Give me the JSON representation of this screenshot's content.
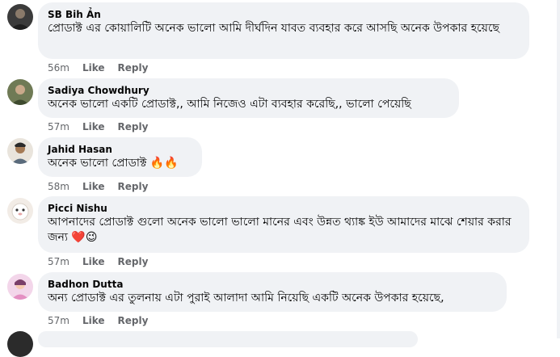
{
  "comments": [
    {
      "author": "SB Bih Ản",
      "text": "প্রোডাক্ট এর কোয়ালিটি অনেক ভালো আমি দীর্ঘদিন যাবত ব্যবহার করে আসছি অনেক উপকার হয়েছে",
      "time": "56m",
      "like": "Like",
      "reply": "Reply",
      "emoji": ""
    },
    {
      "author": "Sadiya Chowdhury",
      "text": "অনেক ভালো একটি প্রোডাক্ট,, আমি নিজেও এটা ব্যবহার করেছি,, ভালো পেয়েছি",
      "time": "57m",
      "like": "Like",
      "reply": "Reply",
      "emoji": ""
    },
    {
      "author": "Jahid Hasan",
      "text": "অনেক ভালো প্রোডাক্ট",
      "time": "58m",
      "like": "Like",
      "reply": "Reply",
      "emoji": "🔥🔥"
    },
    {
      "author": "Picci Nishu",
      "text": "আপনাদের প্রোডাক্ট গুলো অনেক ভালো ভালো মানের এবং উন্নত থ্যাঙ্ক ইউ আমাদের মাঝে শেয়ার করার জন্য",
      "time": "57m",
      "like": "Like",
      "reply": "Reply",
      "emoji": "❤️😉"
    },
    {
      "author": "Badhon Dutta",
      "text": "অন্য প্রোডাক্ট এর তুলনায় এটা পুরাই আলাদা আমি নিয়েছি একটি অনেক উপকার হয়েছে,",
      "time": "57m",
      "like": "Like",
      "reply": "Reply",
      "emoji": ""
    }
  ],
  "colors": {
    "bubble": "#f0f2f5",
    "meta": "#65676b",
    "text": "#050505"
  }
}
